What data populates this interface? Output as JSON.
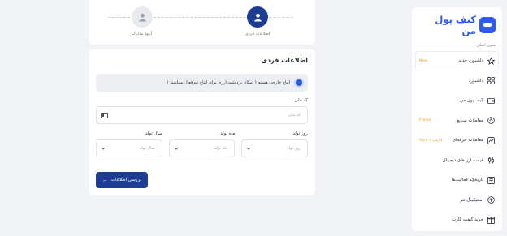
{
  "sidebar": {
    "brand": "کیف پول من",
    "section_label": "منوی اصلی",
    "items": [
      {
        "label": "داشبورد جدید",
        "badge": "New",
        "icon": "new-dashboard-icon"
      },
      {
        "label": "داشبورد",
        "badge": "",
        "icon": "dashboard-grid-icon"
      },
      {
        "label": "کیف پول من",
        "badge": "",
        "icon": "wallet-icon"
      },
      {
        "label": "معاملات سریع",
        "badge": "Promo",
        "icon": "quick-trade-icon"
      },
      {
        "label": "معاملات حرفه‌ای",
        "badge": "کارمزد ۲ تا ۵%",
        "icon": "pro-trade-icon"
      },
      {
        "label": "قیمت ارز های دیجیتال",
        "badge": "",
        "icon": "price-chart-icon"
      },
      {
        "label": "تاریخچه فعالیت‌ها",
        "badge": "",
        "icon": "history-icon"
      },
      {
        "label": "استیکینگ تتر",
        "badge": "",
        "icon": "staking-icon"
      },
      {
        "label": "خرید گیفت کارت",
        "badge": "",
        "icon": "gift-card-icon"
      }
    ]
  },
  "stepper": {
    "steps": [
      {
        "label": "اطلاعات فردی",
        "state": "active"
      },
      {
        "label": "آپلود مدارک",
        "state": "inactive"
      }
    ]
  },
  "form": {
    "title": "اطلاعات فردی",
    "foreign_national_text": "اتباع خارجی هستم ( امکان برداشت ارزی برای اتباع غیرفعال میباشد. )",
    "national_id_label": "کد ملی",
    "national_id_placeholder": "کد ملی",
    "birth_day_label": "روز تولد",
    "birth_day_placeholder": "روز تولد",
    "birth_month_label": "ماه تولد",
    "birth_month_placeholder": "ماه تولد",
    "birth_year_label": "سال تولد",
    "birth_year_placeholder": "سال تولد",
    "submit_label": "بررسی اطلاعات",
    "submit_arrow": "←"
  },
  "colors": {
    "primary": "#1d3d94",
    "brand": "#2f5bea",
    "badge": "#f39c12",
    "background": "#f2f3f6"
  }
}
